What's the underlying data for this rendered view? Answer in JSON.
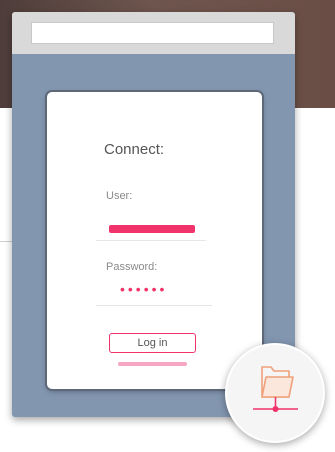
{
  "login": {
    "title": "Connect:",
    "user_label": "User:",
    "password_label": "Password:",
    "password_masked": "••••••",
    "login_button": "Log in"
  },
  "icons": {
    "network_folder": "network-folder-icon"
  },
  "colors": {
    "accent": "#f0336b",
    "accent_light": "#f6a6c3",
    "window_body": "#8296b0",
    "window_header": "#d9d9d9",
    "icon_orange": "#f0a07a"
  }
}
